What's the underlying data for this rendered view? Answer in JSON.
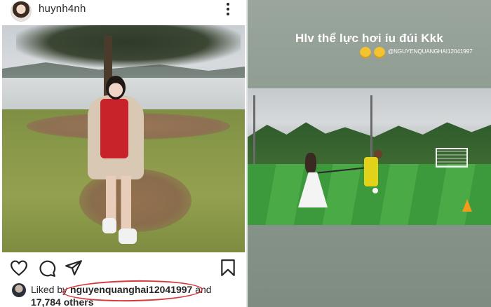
{
  "post": {
    "username": "huynh4nh",
    "likes_prefix": "Liked by ",
    "liker": "nguyenquanghai12041997",
    "likes_and": " and",
    "likes_count": "17,784 others"
  },
  "story": {
    "caption": "Hlv thể lực hơi íu đúi Kkk",
    "mention": "@NGUYENQUANGHAI12041997"
  },
  "colors": {
    "highlight_oval": "#d9393b",
    "story_bg": "#8d9a90",
    "text": "#262626"
  }
}
